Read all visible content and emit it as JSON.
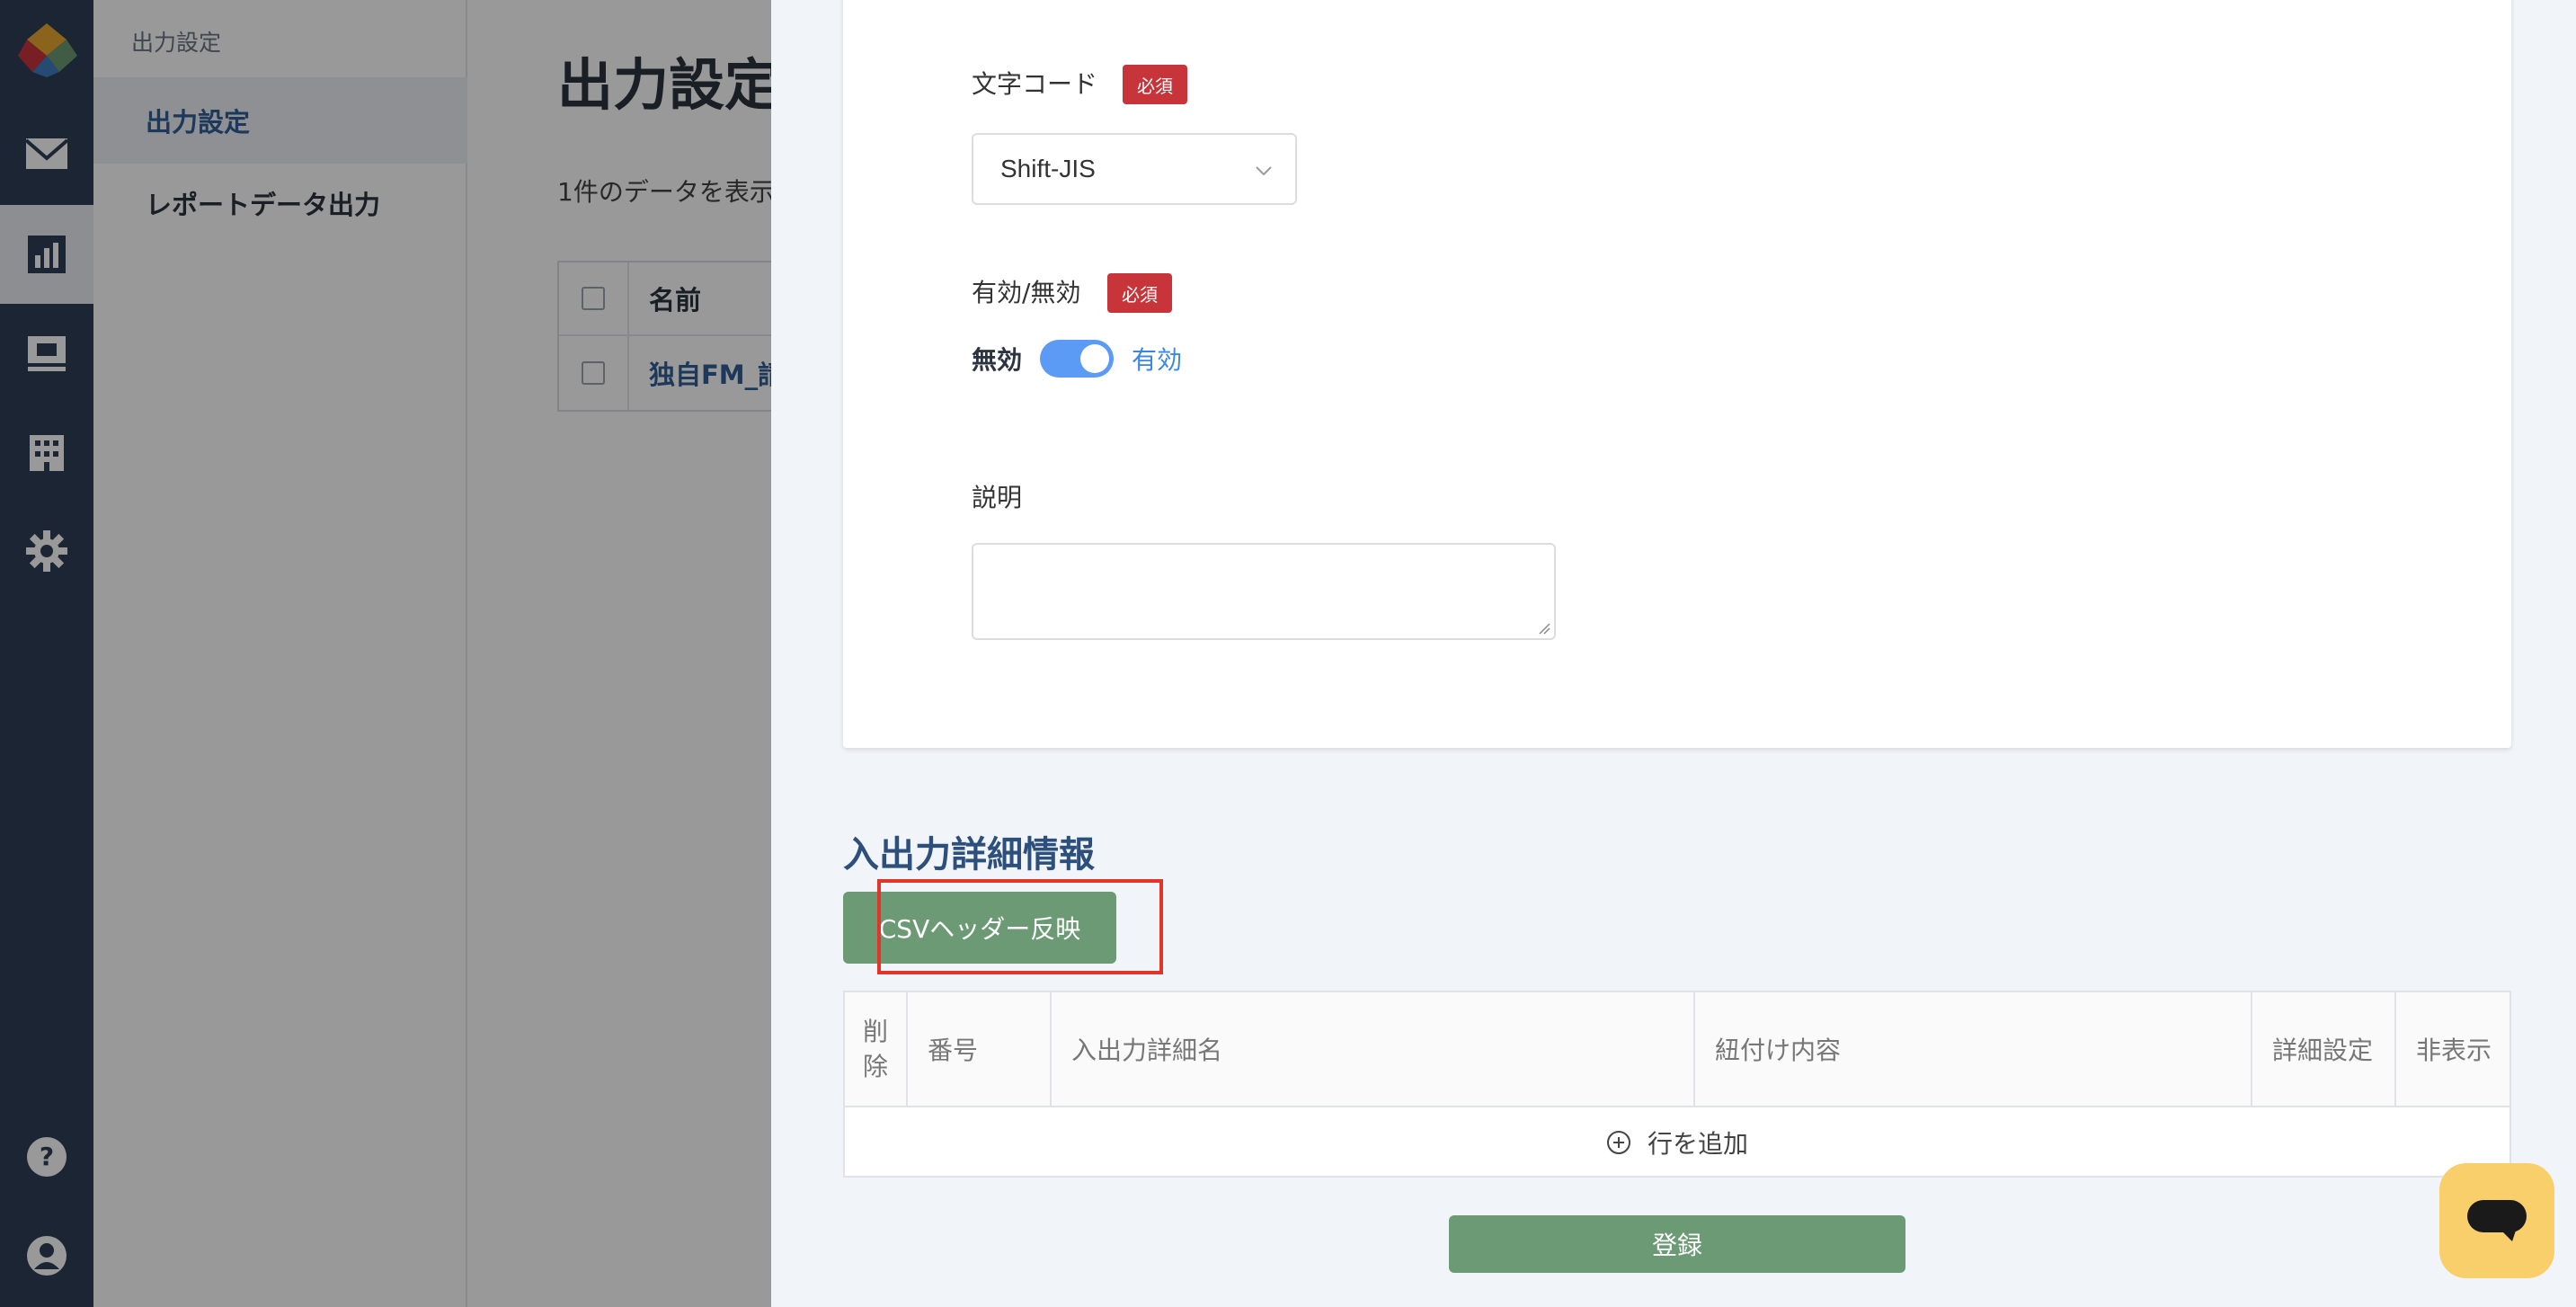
{
  "rail": {
    "items": [
      {
        "icon": "mail-icon"
      },
      {
        "icon": "chart-icon",
        "active": true
      },
      {
        "icon": "presentation-icon"
      },
      {
        "icon": "building-icon"
      },
      {
        "icon": "gear-icon"
      },
      {
        "icon": "help-icon"
      },
      {
        "icon": "user-icon"
      }
    ]
  },
  "subnav": {
    "section_label": "出力設定",
    "items": [
      {
        "label": "出力設定",
        "active": true
      },
      {
        "label": "レポートデータ出力",
        "active": false
      }
    ]
  },
  "background": {
    "title": "出力設定",
    "count_text": "1件のデータを表示",
    "table_header_name": "名前",
    "row_name": "独自FM_請"
  },
  "form": {
    "charset": {
      "label": "文字コード",
      "required": "必須",
      "value": "Shift-JIS"
    },
    "enabled": {
      "label": "有効/無効",
      "required": "必須",
      "off_label": "無効",
      "on_label": "有効",
      "is_on": true
    },
    "description": {
      "label": "説明",
      "value": ""
    }
  },
  "details": {
    "section_title": "入出力詳細情報",
    "csv_button": "CSVヘッダー反映",
    "columns": {
      "delete": "削除",
      "number": "番号",
      "name": "入出力詳細名",
      "mapping": "紐付け内容",
      "settings": "詳細設定",
      "hidden": "非表示"
    },
    "add_row": "行を追加"
  },
  "submit_label": "登録",
  "colors": {
    "rail": "#2f3f55",
    "accent_green": "#6b9a74",
    "required_red": "#c7353a",
    "toggle_blue": "#5b9bf5",
    "highlight": "#e2352a",
    "chat_yellow": "#f8cf6a"
  }
}
